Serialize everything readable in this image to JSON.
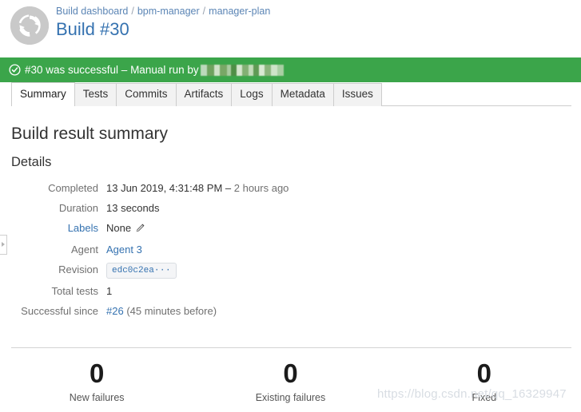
{
  "header": {
    "avatar_icon": "build-sync-icon",
    "breadcrumb": [
      {
        "label": "Build dashboard"
      },
      {
        "label": "bpm-manager"
      },
      {
        "label": "manager-plan"
      }
    ],
    "breadcrumb_separator": "/",
    "title": "Build #30"
  },
  "banner": {
    "icon": "check-circle-icon",
    "text": "#30 was successful – Manual run by",
    "user_redacted": true,
    "background_color": "#3ba54a"
  },
  "sidebar_handle": {
    "icon": "chevron-right-icon"
  },
  "tabs": [
    {
      "label": "Summary",
      "active": true
    },
    {
      "label": "Tests",
      "active": false
    },
    {
      "label": "Commits",
      "active": false
    },
    {
      "label": "Artifacts",
      "active": false
    },
    {
      "label": "Logs",
      "active": false
    },
    {
      "label": "Metadata",
      "active": false
    },
    {
      "label": "Issues",
      "active": false
    }
  ],
  "main": {
    "heading": "Build result summary",
    "subheading": "Details",
    "details": {
      "completed": {
        "label": "Completed",
        "value": "13 Jun 2019, 4:31:48 PM –",
        "relative": "2 hours ago"
      },
      "duration": {
        "label": "Duration",
        "value": "13 seconds"
      },
      "labels": {
        "label": "Labels",
        "value": "None",
        "edit_icon": "pencil-icon"
      },
      "agent": {
        "label": "Agent",
        "value": "Agent 3"
      },
      "revision": {
        "label": "Revision",
        "value": "edc0c2ea",
        "ellipsis": "···"
      },
      "total_tests": {
        "label": "Total tests",
        "value": "1"
      },
      "successful_since": {
        "label": "Successful since",
        "value": "#26",
        "suffix": "(45 minutes before)"
      }
    },
    "stats": [
      {
        "value": "0",
        "label": "New failures"
      },
      {
        "value": "0",
        "label": "Existing failures"
      },
      {
        "value": "0",
        "label": "Fixed"
      }
    ]
  },
  "watermark": {
    "text": "https://blog.csdn.net/qq_16329947"
  }
}
